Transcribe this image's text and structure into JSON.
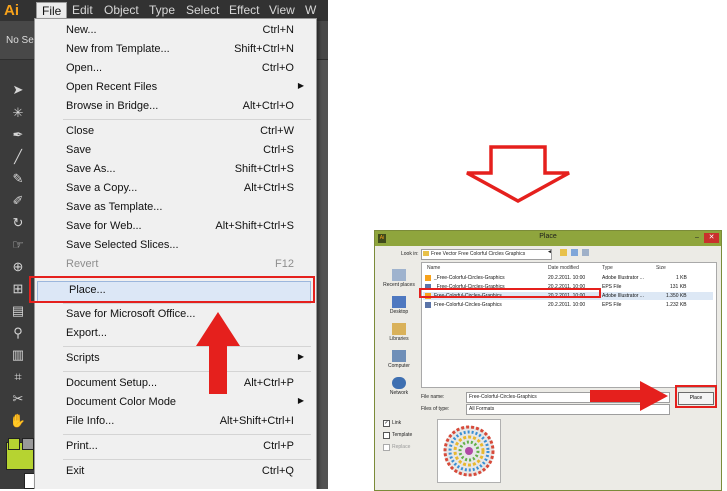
{
  "app": {
    "logo": "Ai",
    "menubar": [
      "File",
      "Edit",
      "Object",
      "Type",
      "Select",
      "Effect",
      "View",
      "W"
    ],
    "control_bar_text": "No Se"
  },
  "file_menu": {
    "items": [
      {
        "label": "New...",
        "shortcut": "Ctrl+N"
      },
      {
        "label": "New from Template...",
        "shortcut": "Shift+Ctrl+N"
      },
      {
        "label": "Open...",
        "shortcut": "Ctrl+O"
      },
      {
        "label": "Open Recent Files",
        "shortcut": ""
      },
      {
        "label": "Browse in Bridge...",
        "shortcut": "Alt+Ctrl+O"
      },
      {
        "label": "Close",
        "shortcut": "Ctrl+W"
      },
      {
        "label": "Save",
        "shortcut": "Ctrl+S"
      },
      {
        "label": "Save As...",
        "shortcut": "Shift+Ctrl+S"
      },
      {
        "label": "Save a Copy...",
        "shortcut": "Alt+Ctrl+S"
      },
      {
        "label": "Save as Template...",
        "shortcut": ""
      },
      {
        "label": "Save for Web...",
        "shortcut": "Alt+Shift+Ctrl+S"
      },
      {
        "label": "Save Selected Slices...",
        "shortcut": ""
      },
      {
        "label": "Revert",
        "shortcut": "F12"
      },
      {
        "label": "Place...",
        "shortcut": ""
      },
      {
        "label": "Save for Microsoft Office...",
        "shortcut": ""
      },
      {
        "label": "Export...",
        "shortcut": ""
      },
      {
        "label": "Scripts",
        "shortcut": ""
      },
      {
        "label": "Document Setup...",
        "shortcut": "Alt+Ctrl+P"
      },
      {
        "label": "Document Color Mode",
        "shortcut": ""
      },
      {
        "label": "File Info...",
        "shortcut": "Alt+Shift+Ctrl+I"
      },
      {
        "label": "Print...",
        "shortcut": "Ctrl+P"
      },
      {
        "label": "Exit",
        "shortcut": "Ctrl+Q"
      }
    ]
  },
  "place_dialog": {
    "title": "Place",
    "look_in_label": "Look in:",
    "look_in_value": "Free Vector Free Colorful Circles Graphics",
    "places": [
      "Recent places",
      "Desktop",
      "Libraries",
      "Computer",
      "Network"
    ],
    "columns": [
      "Name",
      "Date modified",
      "Type",
      "Size"
    ],
    "files": [
      {
        "name": "_Free-Colorful-Circles-Graphics",
        "date": "20.2.2011. 10:00",
        "type": "Adobe Illustrator ...",
        "size": "1 KB"
      },
      {
        "name": "_Free-Colorful-Circles-Graphics",
        "date": "20.2.2011. 10:00",
        "type": "EPS File",
        "size": "131 KB"
      },
      {
        "name": "Free-Colorful-Circles-Graphics",
        "date": "20.2.2011. 10:00",
        "type": "Adobe Illustrator ...",
        "size": "1.350 KB"
      },
      {
        "name": "Free-Colorful-Circles-Graphics",
        "date": "20.2.2011. 10:00",
        "type": "EPS File",
        "size": "1.232 KB"
      }
    ],
    "file_name_label": "File name:",
    "file_name_value": "Free-Colorful-Circles-Graphics",
    "file_type_label": "Files of type:",
    "file_type_value": "All Formats",
    "options": {
      "link": "Link",
      "template": "Template",
      "replace": "Replace"
    },
    "place_button": "Place"
  },
  "colors": {
    "highlight_red": "#e5201d",
    "ai_orange": "#f7a21b",
    "fill_swatch": "#b6d331",
    "dialog_title": "#8fa53d"
  }
}
